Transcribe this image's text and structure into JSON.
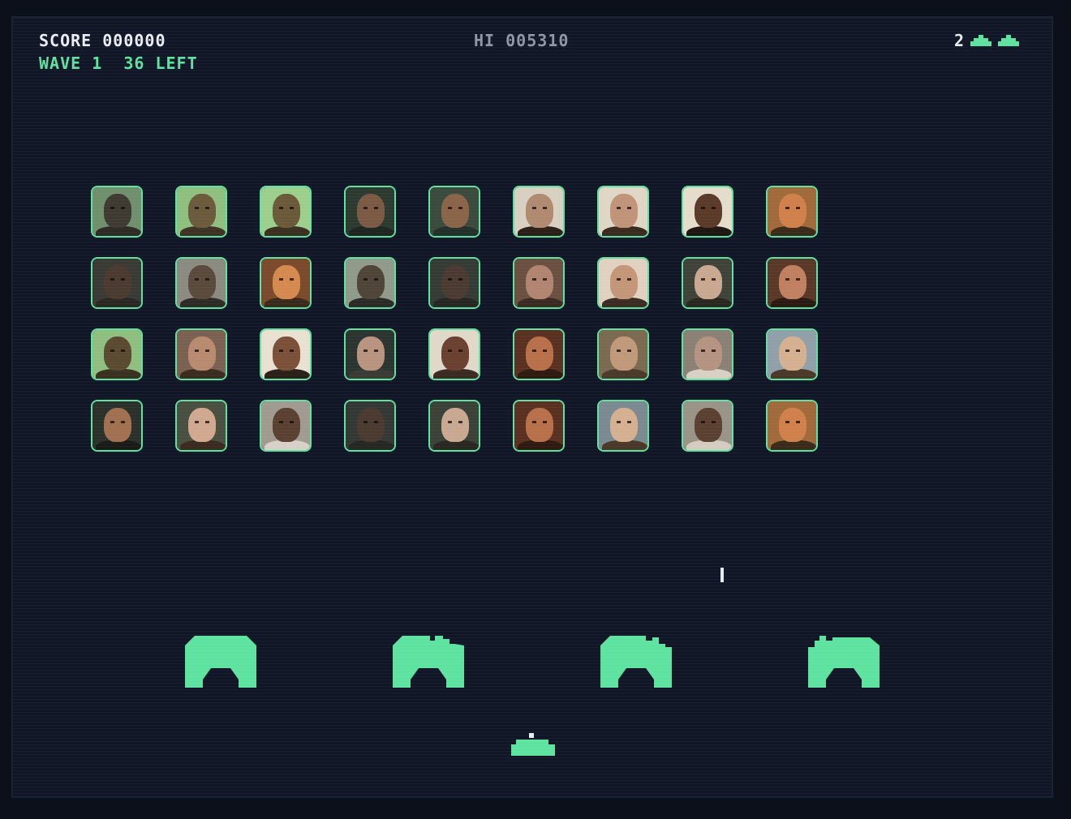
{
  "hud": {
    "score_text": "SCORE 000000",
    "wave_text": "WAVE 1  36 LEFT",
    "hiscore_text": "HI 005310",
    "lives_count": "2",
    "lives_icons": 2
  },
  "invaders": {
    "rows": 4,
    "cols": 9,
    "palettes": [
      [
        "#6f8f6d",
        "#3e3a32",
        "#2e2a25"
      ],
      [
        "#8fbf7f",
        "#6b5a3c",
        "#3d3324"
      ],
      [
        "#9ccf8c",
        "#6a5a3a",
        "#3a3020"
      ],
      [
        "#2d3a30",
        "#7a5a44",
        "#1f2520"
      ],
      [
        "#3a4a3c",
        "#8a6448",
        "#23302a"
      ],
      [
        "#d8d0c0",
        "#b08a70",
        "#2a2018"
      ],
      [
        "#e0d6c6",
        "#c09478",
        "#3a2a20"
      ],
      [
        "#e6dccc",
        "#5a3a28",
        "#1e1612"
      ],
      [
        "#a06a3a",
        "#d0804a",
        "#3a2a1a"
      ],
      [
        "#3a3a34",
        "#4a3a30",
        "#2a2622"
      ],
      [
        "#8a8a80",
        "#5a4a3c",
        "#2e2a26"
      ],
      [
        "#7a4a2a",
        "#d4894f",
        "#3a2a1c"
      ],
      [
        "#909a8a",
        "#4e4438",
        "#2c2a26"
      ],
      [
        "#343a34",
        "#4a3a32",
        "#262622"
      ],
      [
        "#6a5040",
        "#b08470",
        "#3a2a22"
      ],
      [
        "#e0d0c0",
        "#c49678",
        "#3a2c22"
      ],
      [
        "#3e4238",
        "#c8a890",
        "#2a2620"
      ],
      [
        "#5a3828",
        "#c08060",
        "#2a1a12"
      ],
      [
        "#8fbf7f",
        "#5a4a30",
        "#3a3020"
      ],
      [
        "#7a6050",
        "#b88a70",
        "#3a2a20"
      ],
      [
        "#e8e0d0",
        "#7a5038",
        "#2a2018"
      ],
      [
        "#2c3430",
        "#b89480",
        "#3a3a34"
      ],
      [
        "#e0d8c8",
        "#6a4030",
        "#3a2a22"
      ],
      [
        "#5a3020",
        "#b8704a",
        "#2e1a10"
      ],
      [
        "#7a6a50",
        "#c0987a",
        "#4a3a2a"
      ],
      [
        "#8a8074",
        "#b49480",
        "#d8d0c4"
      ],
      [
        "#90a0a8",
        "#d4b090",
        "#4a3828"
      ],
      [
        "#2a302a",
        "#a07050",
        "#1a1a16"
      ],
      [
        "#4a5040",
        "#d0a890",
        "#3a2a20"
      ],
      [
        "#a09a90",
        "#5a4030",
        "#d8d0c6"
      ],
      [
        "#343834",
        "#4a3a30",
        "#262622"
      ],
      [
        "#3a4238",
        "#c8a890",
        "#2a2620"
      ],
      [
        "#5a3020",
        "#b8704a",
        "#2e1a10"
      ],
      [
        "#7a8a90",
        "#d4b090",
        "#4a3828"
      ],
      [
        "#9a9488",
        "#5a4030",
        "#d4ccc0"
      ],
      [
        "#a06a3a",
        "#d0804a",
        "#3a2a1a"
      ]
    ]
  },
  "colors": {
    "accent": "#5ee2a0",
    "background": "#111726",
    "text": "#e9ecf2",
    "muted_text": "#8e96a8"
  }
}
